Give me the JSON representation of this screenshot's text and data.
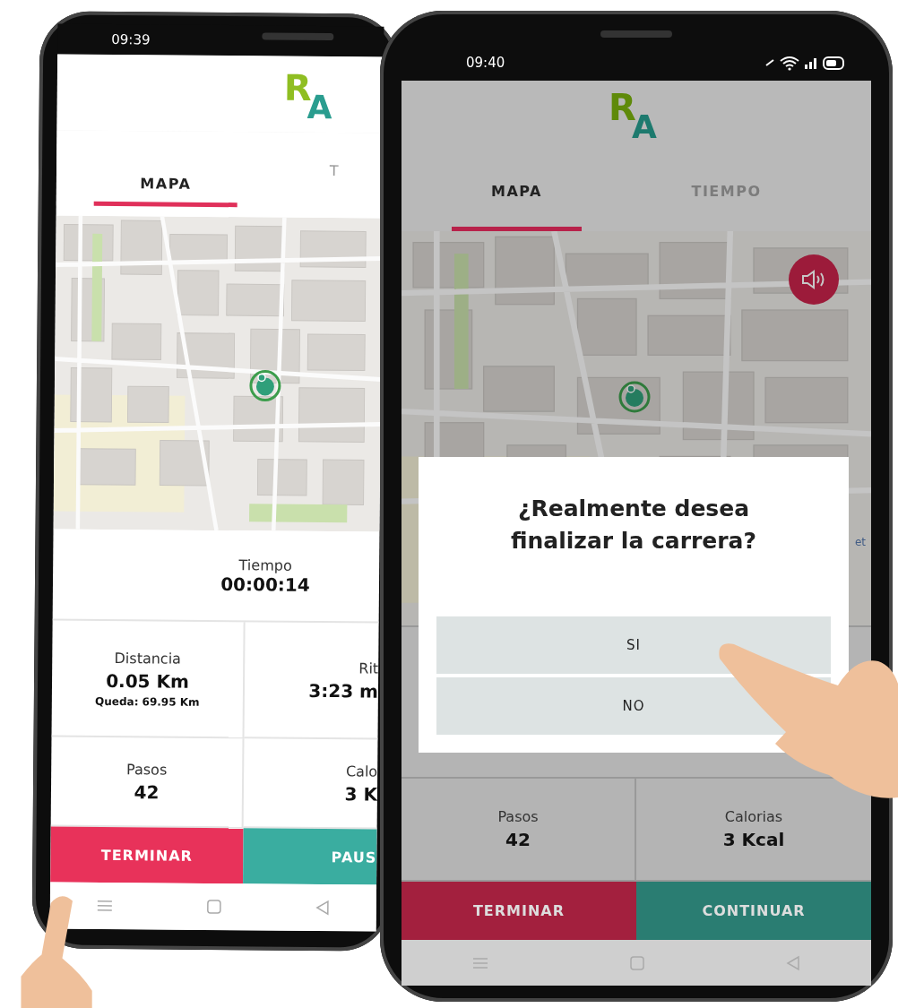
{
  "phones": [
    {
      "time": "09:39",
      "status_icons": false,
      "logo": [
        "R",
        "A"
      ],
      "tabs": [
        {
          "label": "MAPA",
          "selected": true
        },
        {
          "label": "T",
          "selected": false
        }
      ],
      "sound_button": false,
      "summary": {
        "label": "Tiempo",
        "value": "00:00:14"
      },
      "stats": [
        {
          "label": "Distancia",
          "value": "0.05 Km",
          "note": "Queda: 69.95 Km"
        },
        {
          "label": "Rit",
          "value": "3:23 m"
        },
        {
          "label": "Pasos",
          "value": "42"
        },
        {
          "label": "Calo",
          "value": "3 K"
        }
      ],
      "buttons": [
        {
          "label": "TERMINAR",
          "kind": "end"
        },
        {
          "label": "PAUS",
          "kind": "go"
        }
      ]
    },
    {
      "time": "09:40",
      "status_icons": true,
      "logo": [
        "R",
        "A"
      ],
      "tabs": [
        {
          "label": "MAPA",
          "selected": true
        },
        {
          "label": "TIEMPO",
          "selected": false
        }
      ],
      "sound_button": true,
      "map_attribution": "et",
      "stats": [
        {
          "label": "Pasos",
          "value": "42"
        },
        {
          "label": "Calorias",
          "value": "3 Kcal"
        }
      ],
      "buttons": [
        {
          "label": "TERMINAR",
          "kind": "end"
        },
        {
          "label": "CONTINUAR",
          "kind": "go"
        }
      ],
      "dialog": {
        "question": "¿Realmente desea finalizar la carrera?",
        "options": [
          "SI",
          "NO"
        ]
      }
    }
  ]
}
